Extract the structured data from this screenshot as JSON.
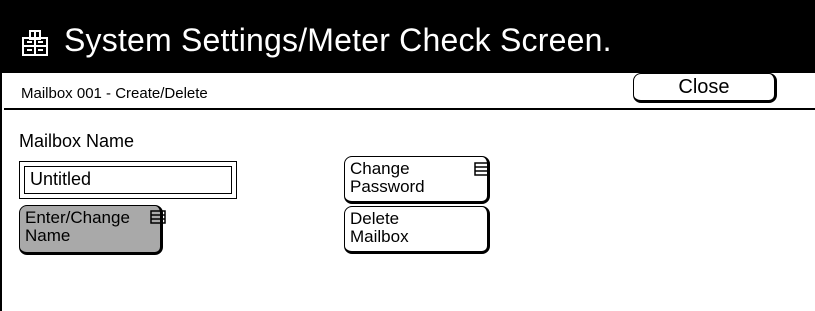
{
  "header": {
    "title": "System Settings/Meter Check Screen.",
    "icon": "system-settings-icon"
  },
  "subheader": {
    "label": "Mailbox 001 - Create/Delete",
    "close_label": "Close"
  },
  "mailbox": {
    "name_label": "Mailbox Name",
    "name_value": "Untitled"
  },
  "buttons": {
    "enter_change_name": [
      "Enter/Change",
      "Name"
    ],
    "change_password": [
      "Change",
      "Password"
    ],
    "delete_mailbox": [
      "Delete",
      "Mailbox"
    ]
  },
  "colors": {
    "title_bar": "#000000",
    "title_text": "#ffffff",
    "selected_button": "#a9a9a9",
    "background": "#ffffff"
  }
}
